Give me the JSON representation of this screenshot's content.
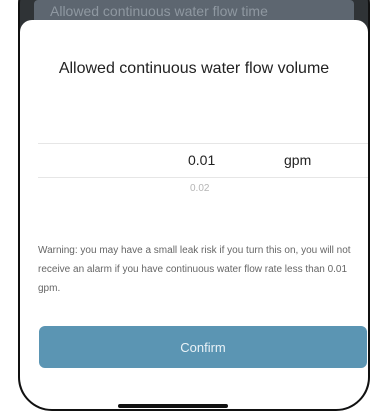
{
  "background": {
    "row_label": "Allowed continuous water flow time"
  },
  "sheet": {
    "title": "Allowed continuous water flow volume",
    "picker": {
      "selected_value": "0.01",
      "unit": "gpm",
      "next_value": "0.02"
    },
    "warning": "Warning: you may have a small leak risk if you turn this on, you will not receive an alarm if you have continuous water flow rate less than 0.01 gpm.",
    "confirm_label": "Confirm"
  },
  "colors": {
    "accent": "#5b95b3",
    "overlay": "#2f3336"
  }
}
